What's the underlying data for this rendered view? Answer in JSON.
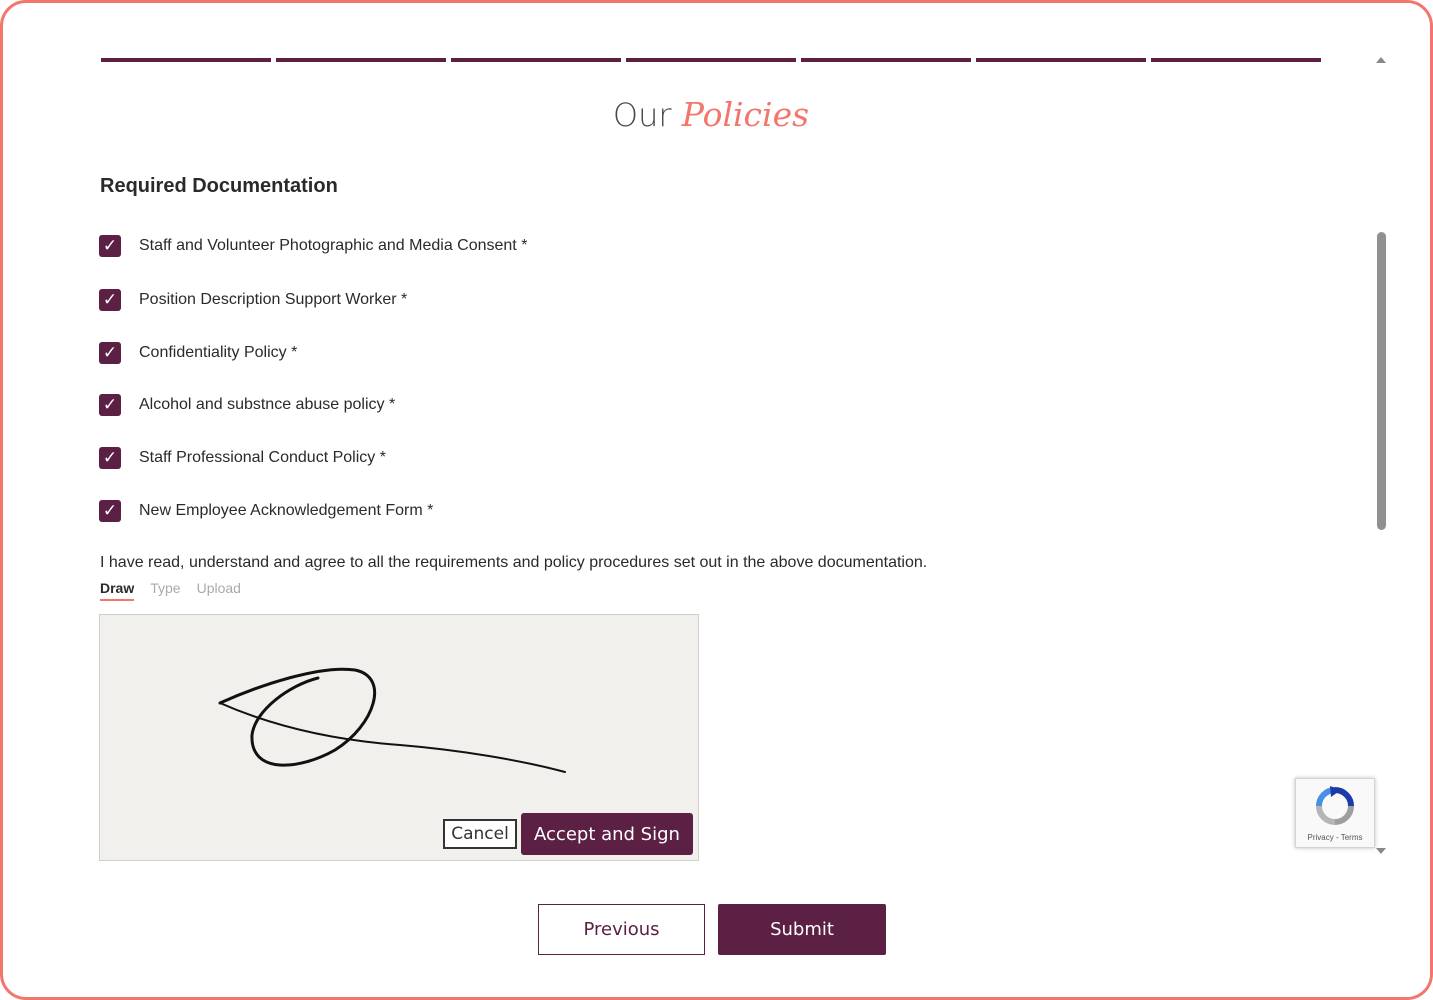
{
  "header": {
    "title_prefix": "Our",
    "title_accent": "Policies",
    "progress_steps": 7,
    "progress_complete": 7
  },
  "section": {
    "heading": "Required Documentation"
  },
  "documents": [
    {
      "label": "Staff and Volunteer Photographic and Media Consent *",
      "checked": true
    },
    {
      "label": "Position Description Support Worker *",
      "checked": true
    },
    {
      "label": "Confidentiality Policy *",
      "checked": true
    },
    {
      "label": "Alcohol and substnce abuse policy *",
      "checked": true
    },
    {
      "label": "Staff Professional Conduct Policy *",
      "checked": true
    },
    {
      "label": "New Employee Acknowledgement Form *",
      "checked": true
    }
  ],
  "agreement": {
    "text": "I have read, understand and agree to all the requirements and policy procedures set out in the above documentation."
  },
  "signature": {
    "tabs": [
      {
        "label": "Draw",
        "active": true
      },
      {
        "label": "Type",
        "active": false
      },
      {
        "label": "Upload",
        "active": false
      }
    ],
    "cancel_label": "Cancel",
    "accept_label": "Accept and Sign"
  },
  "recaptcha": {
    "links": "Privacy - Terms"
  },
  "nav": {
    "previous_label": "Previous",
    "submit_label": "Submit"
  },
  "colors": {
    "brand": "#5b2043",
    "accent": "#f2766b"
  }
}
